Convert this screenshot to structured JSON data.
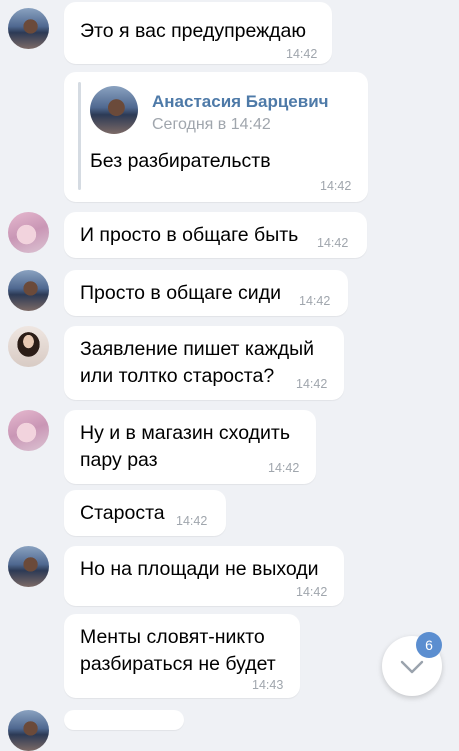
{
  "messages": [
    {
      "text": "Это я вас предупреждаю",
      "time": "14:42"
    },
    {
      "quote": {
        "author": "Анастасия Барцевич",
        "date": "Сегодня в 14:42",
        "text": "Без разбирательств"
      },
      "time": "14:42"
    },
    {
      "text": "И просто в общаге быть",
      "time": "14:42"
    },
    {
      "text": "Просто в общаге сиди",
      "time": "14:42"
    },
    {
      "lines": [
        "Заявление пишет каждый",
        "или толтко староста?"
      ],
      "time": "14:42"
    },
    {
      "lines": [
        "Ну и в магазин сходить",
        "пару раз"
      ],
      "time": "14:42"
    },
    {
      "text": "Староста",
      "time": "14:42"
    },
    {
      "text": "Но на площади не выходи",
      "time": "14:42"
    },
    {
      "lines": [
        "Менты словят-никто",
        "разбираться не будет"
      ],
      "time": "14:43"
    }
  ],
  "scroll_button": {
    "badge": "6",
    "icon": "chevron-down-icon"
  },
  "colors": {
    "background": "#eff1f5",
    "bubble": "#ffffff",
    "link": "#4e7aa8",
    "badge": "#5b8ed0"
  }
}
